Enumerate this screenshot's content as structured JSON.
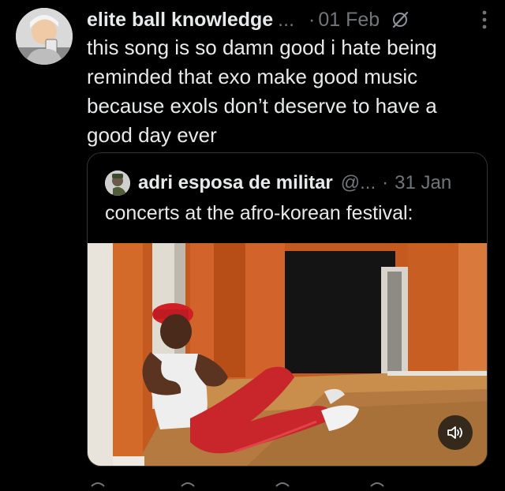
{
  "tweet": {
    "author_name": "elite ball knowledge",
    "author_truncation": "...",
    "separator": "·",
    "date": "01 Feb",
    "text": "this song is so damn good i hate being reminded that exo make good music because exols don’t deserve to have a good day ever",
    "icons": {
      "avatar": "avatar-photo",
      "grok": "grok-icon",
      "more": "more-vertical-icon"
    }
  },
  "quote": {
    "author_name": "adri esposa de militar",
    "handle": "@...",
    "separator": "·",
    "date": "31 Jan",
    "text": "concerts at the afro-korean festival:",
    "icons": {
      "avatar": "quote-avatar-photo",
      "sound": "speaker-icon"
    }
  },
  "colors": {
    "background": "#000000",
    "text_primary": "#e7e9ea",
    "text_secondary": "#71767b",
    "border": "#2f3336",
    "wall_orange": "#c2561b"
  }
}
